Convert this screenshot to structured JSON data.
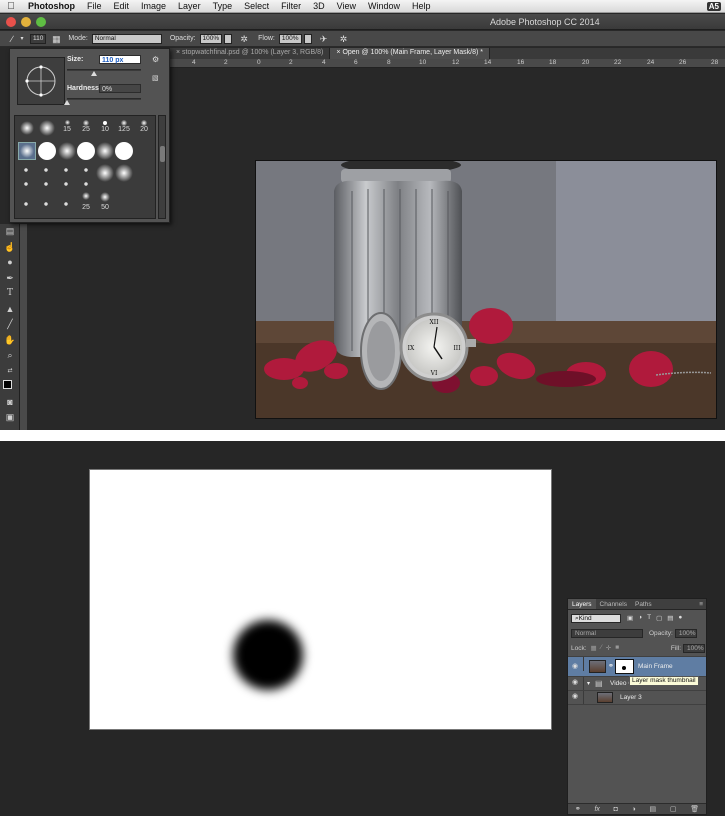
{
  "menubar": {
    "app_name": "Photoshop",
    "items": [
      "File",
      "Edit",
      "Image",
      "Layer",
      "Type",
      "Select",
      "Filter",
      "3D",
      "View",
      "Window",
      "Help"
    ],
    "right_badge": "A5"
  },
  "window": {
    "title": "Adobe Photoshop CC 2014"
  },
  "options_bar": {
    "brush_size": "110",
    "mode_label": "Mode:",
    "mode_value": "Normal",
    "opacity_label": "Opacity:",
    "opacity_value": "100%",
    "flow_label": "Flow:",
    "flow_value": "100%"
  },
  "tabs": [
    {
      "label": "stopwatchfinal.psd @ 100% (Layer 3, RGB/8)",
      "active": false
    },
    {
      "label": "Open @ 100% (Main Frame, Layer Mask/8) *",
      "active": true
    }
  ],
  "ruler_ticks": [
    "4",
    "2",
    "0",
    "2",
    "4",
    "6",
    "8",
    "10",
    "12",
    "14",
    "16",
    "18",
    "20",
    "22",
    "24",
    "26",
    "28"
  ],
  "brush_panel": {
    "size_label": "Size:",
    "size_value": "110 px",
    "hardness_label": "Hardness:",
    "hardness_value": "0%",
    "size_level": 0.37,
    "hardness_level": 0.0,
    "preset_numbers": [
      "15",
      "25",
      "10",
      "125",
      "20",
      "25",
      "50"
    ]
  },
  "layers_panel": {
    "tabs": [
      "Layers",
      "Channels",
      "Paths"
    ],
    "filter_label": "Kind",
    "blend_mode": "Normal",
    "opacity_label": "Opacity:",
    "opacity_value": "100%",
    "lock_label": "Lock:",
    "fill_label": "Fill:",
    "fill_value": "100%",
    "layers": [
      {
        "name": "Main Frame",
        "selected": true
      },
      {
        "name": "Video G",
        "selected": false
      },
      {
        "name": "Layer 3",
        "selected": false
      }
    ],
    "tooltip": "Layer mask thumbnail"
  },
  "colors": {
    "ui_dark": "#282828",
    "panel_gray": "#535353",
    "selected_layer": "#5f7da3",
    "petal_red": "#b01a3c"
  }
}
